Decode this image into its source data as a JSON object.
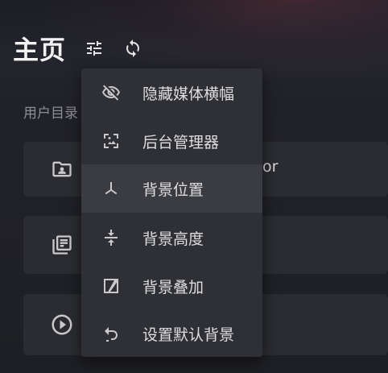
{
  "header": {
    "title": "主页",
    "settings_icon": "tune-icon",
    "sync_icon": "sync-icon"
  },
  "sections": {
    "user_library_label": "用户目录",
    "peek_text": "or"
  },
  "library_cards": [
    {
      "icon": "folder-account-icon"
    },
    {
      "icon": "library-books-icon"
    },
    {
      "icon": "play-circle-icon"
    }
  ],
  "menu": {
    "items": [
      {
        "label": "隐藏媒体横幅",
        "icon": "eye-off-icon"
      },
      {
        "label": "后台管理器",
        "icon": "image-frame-icon"
      },
      {
        "label": "背景位置",
        "icon": "axis-icon",
        "active": true
      },
      {
        "label": "背景高度",
        "icon": "vertical-compress-icon"
      },
      {
        "label": "背景叠加",
        "icon": "overlay-icon"
      },
      {
        "label": "设置默认背景",
        "icon": "undo-icon"
      }
    ]
  },
  "colors": {
    "background": "#1e1f23",
    "menu_bg": "#2f3035",
    "menu_active": "#3b3c42",
    "text_primary": "#dedede",
    "icon": "#c9c9c9"
  }
}
